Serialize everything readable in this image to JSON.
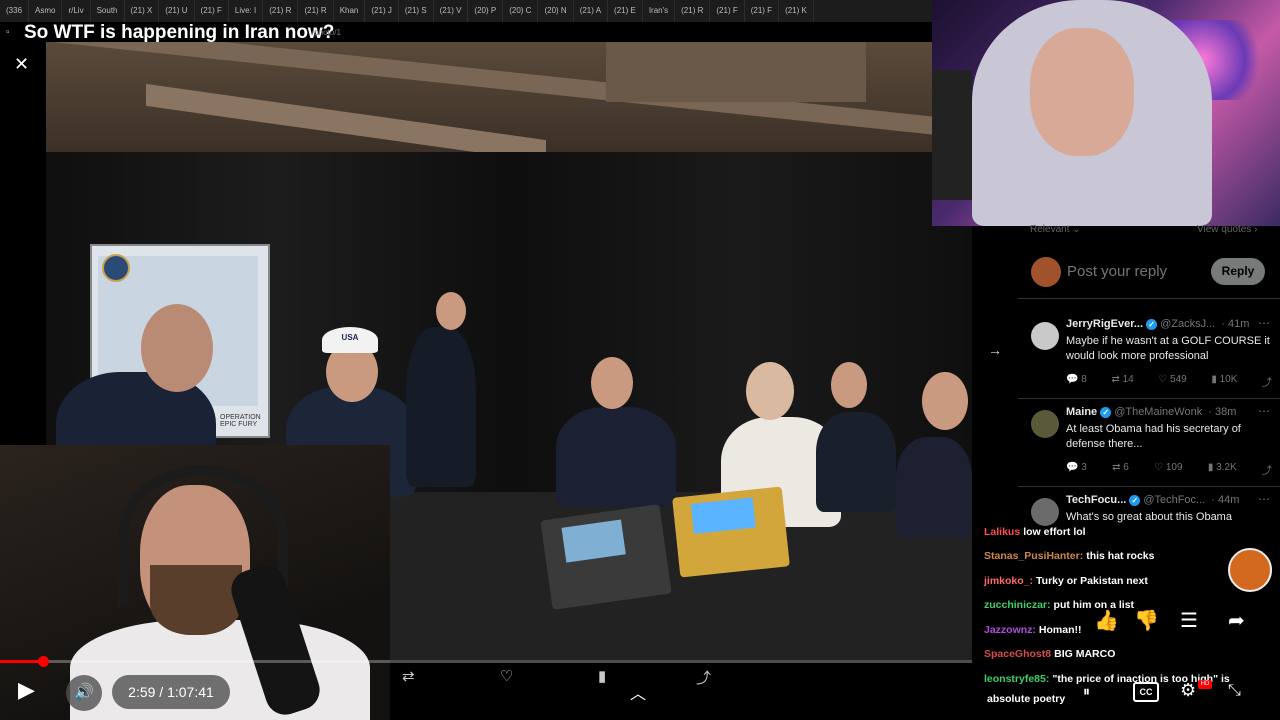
{
  "browser": {
    "tabs": [
      "(336",
      "Asmo",
      "r/Liv",
      "South",
      "(21) X",
      "(21) U",
      "(21) F",
      "Live: I",
      "(21) R",
      "(21) R",
      "Khan",
      "(21) J",
      "(21) S",
      "(21) V",
      "(20) P",
      "(20) C",
      "(20) N",
      "(21) A",
      "(21) E",
      "Iran's",
      "(21) R",
      "(21) F",
      "(21) F",
      "(21) K"
    ],
    "url_fragment": "/photo/1"
  },
  "video": {
    "title": "So WTF is happening in Iran now?",
    "time_display": "2:59 / 1:07:41",
    "progress_fraction": 0.044
  },
  "photo": {
    "cap_text": "USA",
    "map_caption": "OPERATION EPIC FURY"
  },
  "x_panel": {
    "tab_left": "Relevant ⌄",
    "tab_right": "View quotes ›",
    "reply_placeholder": "Post your reply",
    "reply_button": "Reply",
    "tweets": [
      {
        "name": "JerryRigEver...",
        "handle": "@ZacksJ...",
        "time": "· 41m",
        "text": "Maybe if he wasn't at a GOLF COURSE it would look more professional",
        "replies": "8",
        "reposts": "14",
        "likes": "549",
        "views": "10K",
        "avatar_color": "#c9c9c9"
      },
      {
        "name": "Maine",
        "handle": "@TheMaineWonk",
        "time": "· 38m",
        "text": "At least Obama had his secretary of defense there...",
        "replies": "3",
        "reposts": "6",
        "likes": "109",
        "views": "3.2K",
        "avatar_color": "#5a5a3a"
      },
      {
        "name": "TechFocu...",
        "handle": "@TechFoc...",
        "time": "· 44m",
        "text": "What's so great about this Obama",
        "avatar_color": "#6b6b6b"
      }
    ]
  },
  "chat": {
    "lines": [
      {
        "user": "Lalikus",
        "msg": "low effort lol",
        "color": "#ff4d4d"
      },
      {
        "user": "Stanas_PusiHanter:",
        "msg": "this hat rocks",
        "color": "#cc8844"
      },
      {
        "user": "jimkoko_:",
        "msg": "Turky or Pakistan next",
        "color": "#ff6a6a"
      },
      {
        "user": "zucchiniczar:",
        "msg": "put him on a list",
        "color": "#3ecf6e"
      },
      {
        "user": "Jazzownz:",
        "msg": "Homan!!",
        "color": "#b04cd9"
      },
      {
        "user": "SpaceGhost8",
        "msg": "BIG MARCO",
        "color": "#d94c4c"
      },
      {
        "user": "leonstryfe85:",
        "msg": "\"the price of inaction is too high\" is",
        "color": "#3ecf6e"
      },
      {
        "user": "",
        "msg": "absolute poetry",
        "color": "#ffffff"
      }
    ]
  },
  "controls": {
    "cc_label": "CC",
    "hd_label": "HD"
  },
  "icons": {
    "play": "play-icon",
    "volume": "volume-icon",
    "like": "thumbs-up-icon",
    "dislike": "thumbs-down-icon",
    "comments": "comments-icon",
    "share": "share-icon",
    "settings": "gear-icon",
    "fullscreen": "fullscreen-icon"
  }
}
